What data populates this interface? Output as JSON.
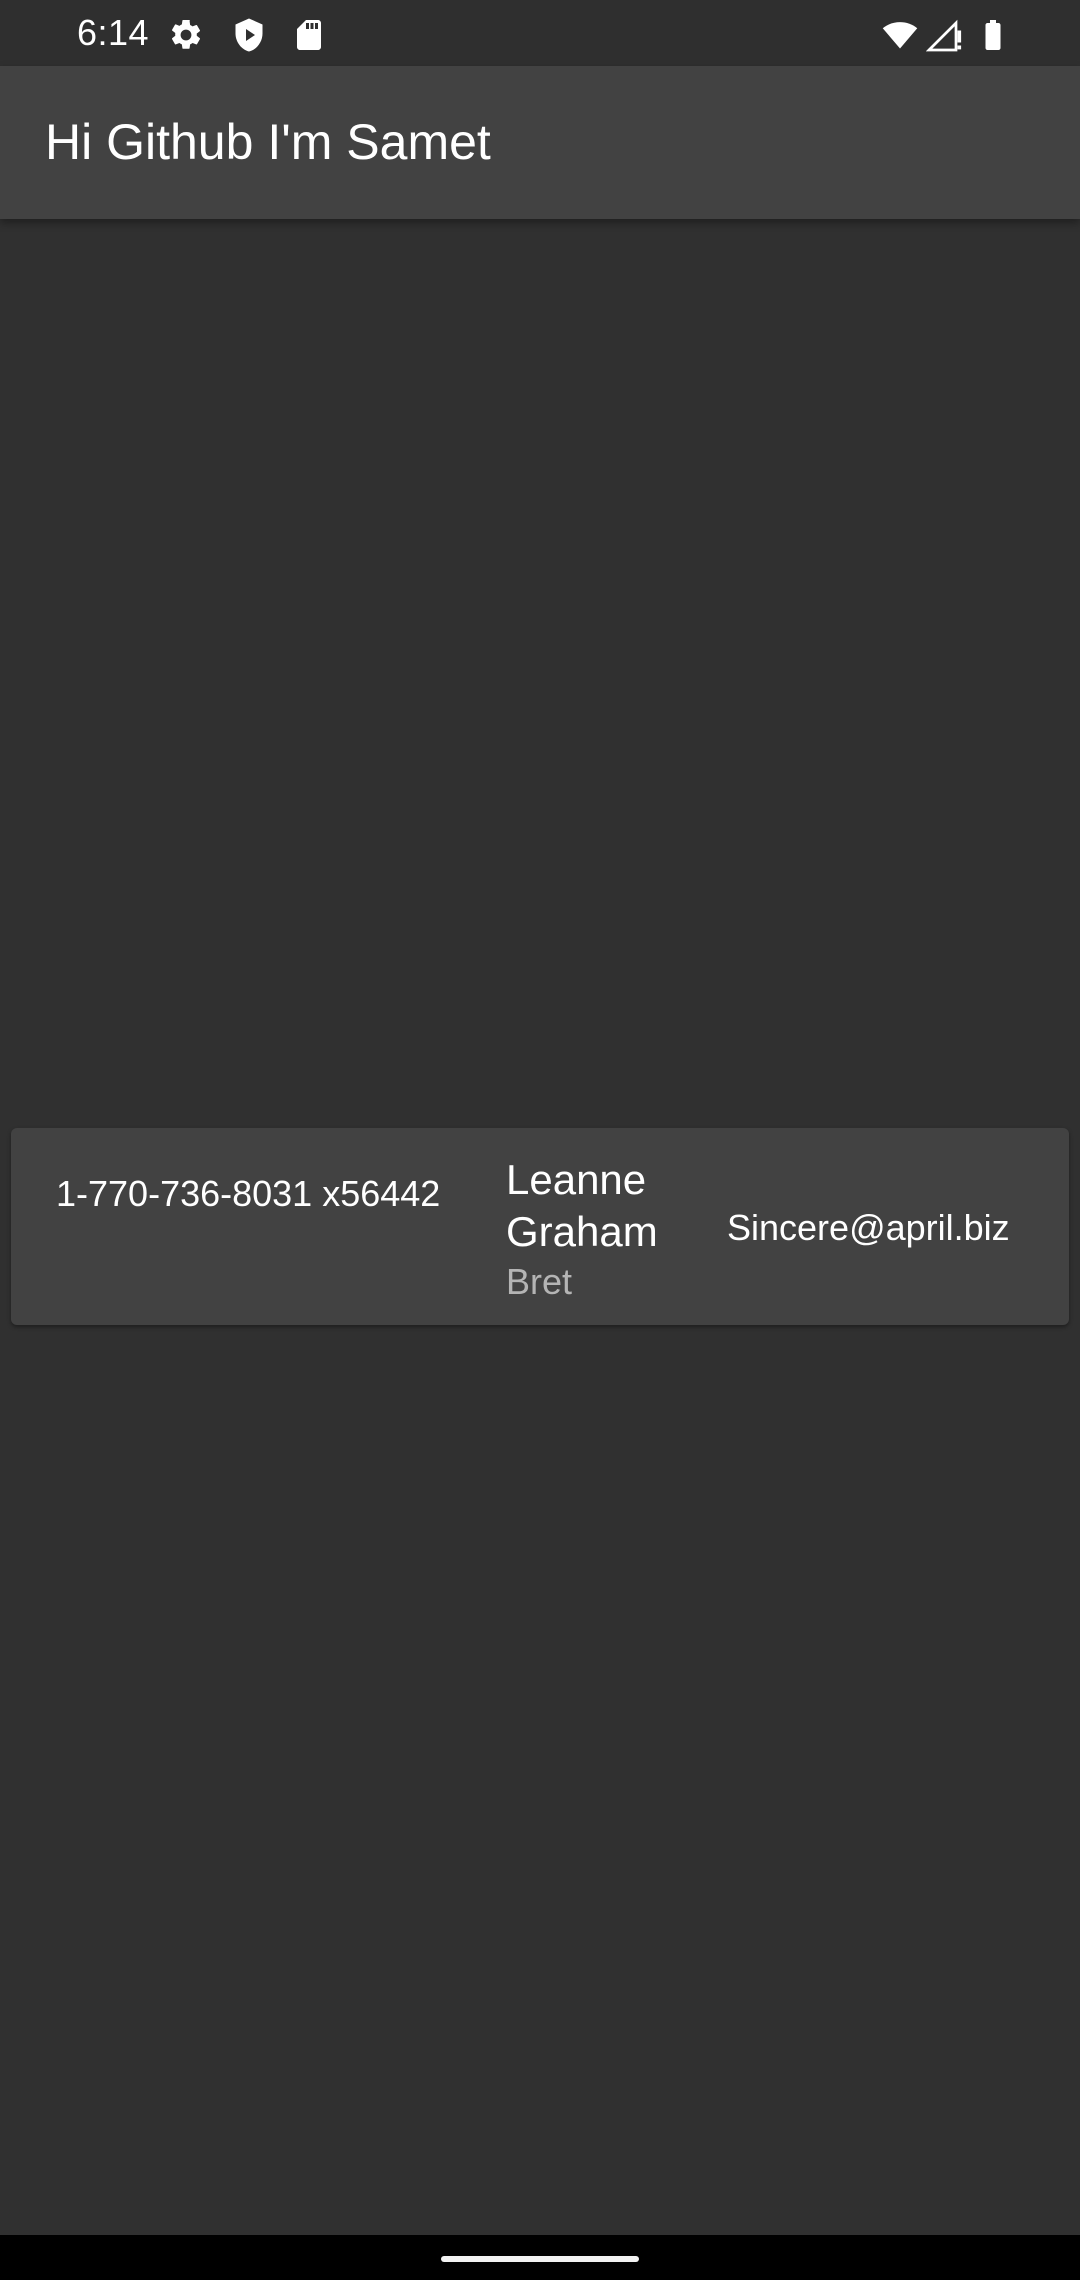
{
  "status_bar": {
    "time": "6:14",
    "left_icons": [
      "settings-icon",
      "shield-play-icon",
      "sd-card-icon"
    ],
    "right_icons": [
      "wifi-icon",
      "signal-icon",
      "battery-icon"
    ]
  },
  "app_bar": {
    "title": "Hi Github I'm Samet"
  },
  "users": [
    {
      "phone": "1-770-736-8031 x56442",
      "name": "Leanne Graham",
      "username": "Bret",
      "email": "Sincere@april.biz"
    }
  ],
  "colors": {
    "background": "#303030",
    "app_bar": "#424242",
    "card": "#424242",
    "secondary_text": "#b4b4b4",
    "nav_bar": "#000000"
  }
}
